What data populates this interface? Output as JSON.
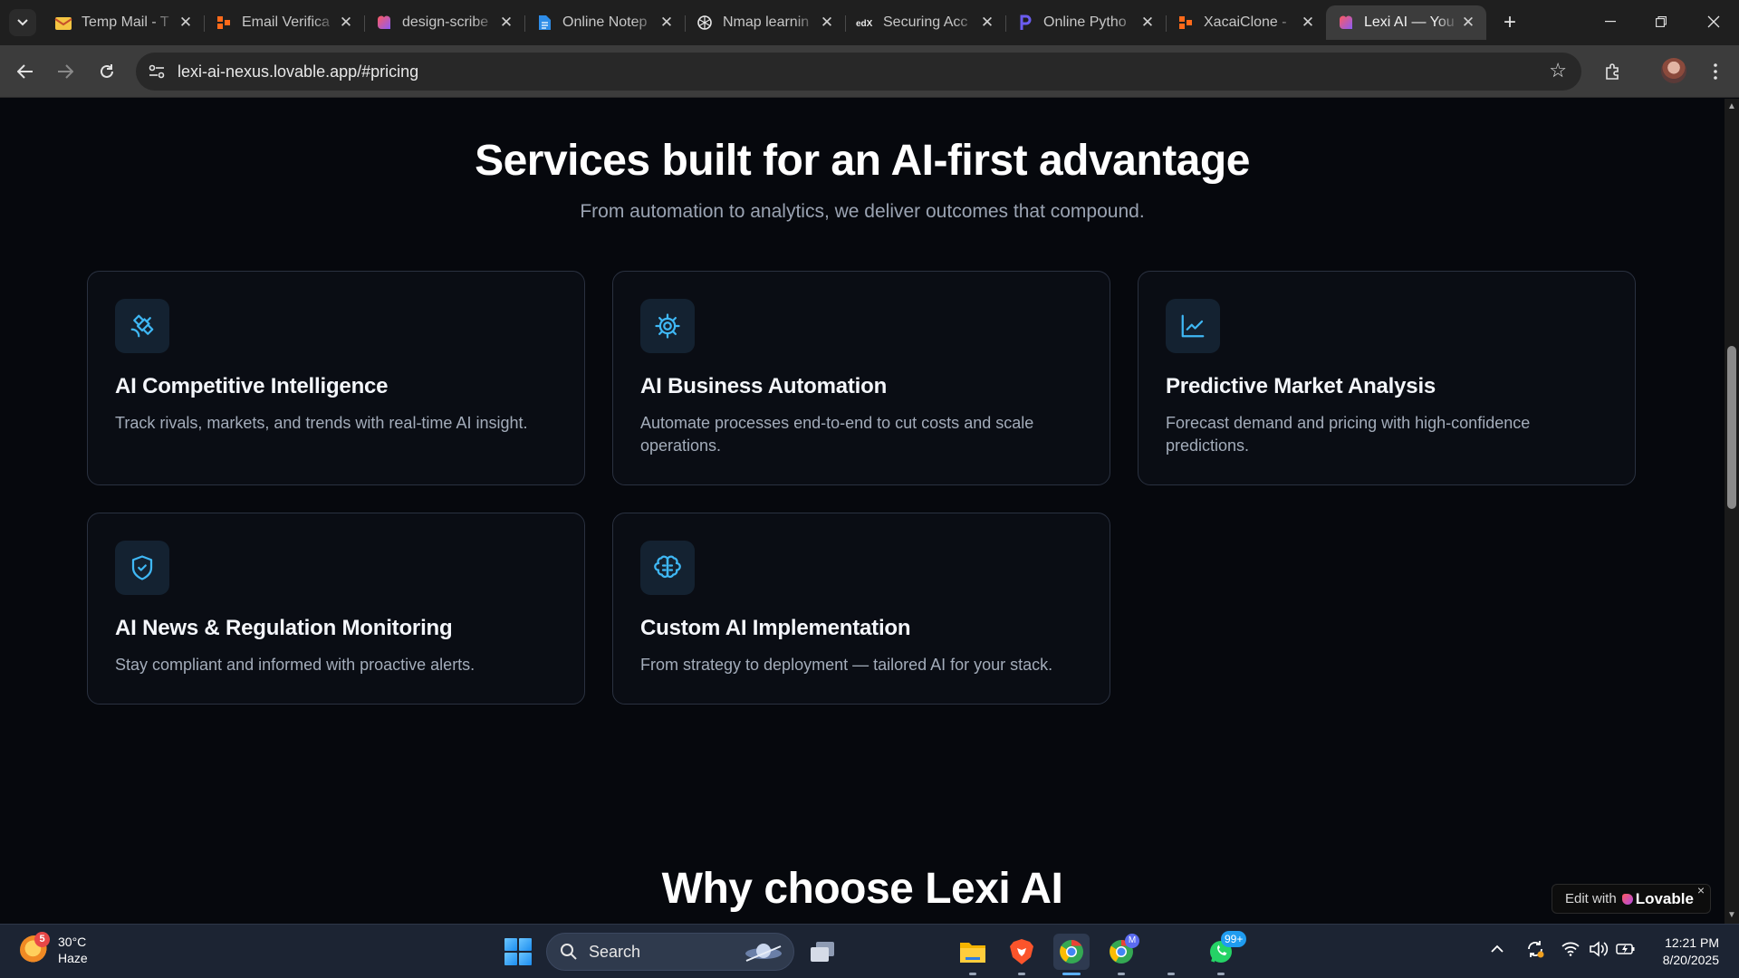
{
  "browser": {
    "tabs": [
      {
        "title": "Temp Mail - T",
        "icon": "temp-mail-envelope-icon",
        "active": false
      },
      {
        "title": "Email Verifica",
        "icon": "email-verify-icon",
        "active": false
      },
      {
        "title": "design-scribe",
        "icon": "lovable-heart-icon",
        "active": false
      },
      {
        "title": "Online Notep",
        "icon": "notepad-doc-icon",
        "active": false
      },
      {
        "title": "Nmap learnin",
        "icon": "chatgpt-icon",
        "active": false
      },
      {
        "title": "Securing Acc",
        "icon": "edx-icon",
        "active": false
      },
      {
        "title": "Online Pytho",
        "icon": "python-p-icon",
        "active": false
      },
      {
        "title": "XacaiClone -",
        "icon": "xacai-icon",
        "active": false
      },
      {
        "title": "Lexi AI — You",
        "icon": "lovable-heart-icon",
        "active": true
      }
    ],
    "url": "lexi-ai-nexus.lovable.app/#pricing"
  },
  "page": {
    "title": "Services built for an AI-first advantage",
    "subtitle": "From automation to analytics, we deliver outcomes that compound.",
    "services": [
      {
        "icon": "satellite-icon",
        "title": "AI Competitive Intelligence",
        "description": "Track rivals, markets, and trends with real-time AI insight."
      },
      {
        "icon": "gear-icon",
        "title": "AI Business Automation",
        "description": "Automate processes end-to-end to cut costs and scale operations."
      },
      {
        "icon": "line-chart-icon",
        "title": "Predictive Market Analysis",
        "description": "Forecast demand and pricing with high-confidence predictions."
      },
      {
        "icon": "shield-check-icon",
        "title": "AI News & Regulation Monitoring",
        "description": "Stay compliant and informed with proactive alerts."
      },
      {
        "icon": "brain-icon",
        "title": "Custom AI Implementation",
        "description": "From strategy to deployment — tailored AI for your stack."
      }
    ],
    "next_section_title": "Why choose Lexi AI",
    "edit_badge": {
      "prefix": "Edit with",
      "brand": "Lovable",
      "close": "×"
    }
  },
  "taskbar": {
    "weather": {
      "badge": "5",
      "temp": "30°C",
      "condition": "Haze"
    },
    "search_label": "Search",
    "whatsapp_badge": "99+",
    "chrome_profile_badge": "M",
    "clock": {
      "time": "12:21 PM",
      "date": "8/20/2025"
    }
  },
  "colors": {
    "accent": "#3fb8f5",
    "background": "#06080d",
    "card_border": "#2a3140",
    "icon_tile": "#142231"
  }
}
